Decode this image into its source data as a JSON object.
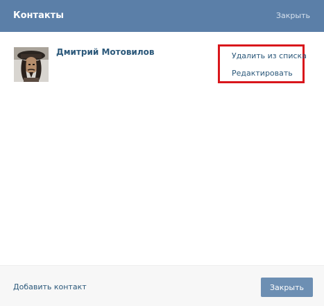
{
  "header": {
    "title": "Контакты",
    "close_label": "Закрыть"
  },
  "contact": {
    "name": "Дмитрий Мотовилов",
    "avatar_icon": "user-photo"
  },
  "actions": {
    "remove_label": "Удалить из списка",
    "edit_label": "Редактировать",
    "highlight_color": "#d9161b"
  },
  "footer": {
    "add_contact_label": "Добавить контакт",
    "close_button_label": "Закрыть"
  },
  "colors": {
    "header_bg": "#5b7fa8",
    "link": "#2b587a",
    "button_bg": "#6d8fb3"
  }
}
